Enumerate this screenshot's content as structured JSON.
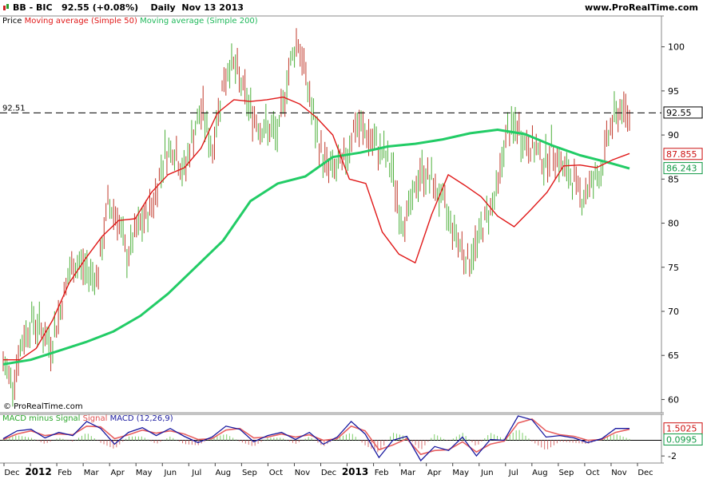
{
  "header": {
    "symbol": "BB - BIC",
    "last_price": "92.55",
    "change": "(+0.08%)",
    "period": "Daily",
    "date": "Nov 13 2013",
    "site": "www.ProRealTime.com"
  },
  "legend": {
    "price": "Price",
    "ma50": "Moving average (Simple 50)",
    "ma200": "Moving average (Simple 200)"
  },
  "watermark": "© ProRealTime.com",
  "macd_legend": {
    "hist": "MACD minus Signal",
    "signal": "Signal",
    "macd": "MACD (12,26,9)"
  },
  "colors": {
    "ma50": "#e01818",
    "ma200": "#22cc66",
    "up_bar": "#4caf3a",
    "down_bar": "#c0392b",
    "macd": "#1a1aa0",
    "signal": "#e86060",
    "ref_line": "#000000"
  },
  "chart_data": {
    "type": "line",
    "x_axis": {
      "labels": [
        "Dec",
        "2012",
        "Feb",
        "Mar",
        "Apr",
        "May",
        "Jun",
        "Jul",
        "Aug",
        "Sep",
        "Oct",
        "Nov",
        "Dec",
        "2013",
        "Feb",
        "Mar",
        "Apr",
        "May",
        "Jun",
        "Jul",
        "Aug",
        "Sep",
        "Oct",
        "Nov",
        "Dec"
      ],
      "bold_labels": [
        "2012",
        "2013"
      ]
    },
    "y_axis": {
      "ticks": [
        60,
        65,
        70,
        75,
        80,
        85,
        90,
        95,
        100
      ],
      "range": [
        58.5,
        103.5
      ]
    },
    "reference_line": {
      "value": 92.51,
      "label": "92.51",
      "style": "dashed"
    },
    "markers": [
      {
        "label": "92.55",
        "value": 92.55,
        "style": "box-black"
      },
      {
        "label": "87.855",
        "value": 87.855,
        "style": "box-red"
      },
      {
        "label": "86.243",
        "value": 86.243,
        "style": "box-green"
      }
    ],
    "price_path": [
      [
        0,
        64
      ],
      [
        1,
        62
      ],
      [
        2,
        66.5
      ],
      [
        3,
        69
      ],
      [
        4,
        68
      ],
      [
        5,
        66
      ],
      [
        6,
        70
      ],
      [
        7,
        74.5
      ],
      [
        8,
        75.5
      ],
      [
        9,
        74.5
      ],
      [
        10,
        74
      ],
      [
        11,
        82
      ],
      [
        12,
        81
      ],
      [
        13,
        76
      ],
      [
        14,
        79
      ],
      [
        15,
        80.5
      ],
      [
        16,
        83
      ],
      [
        17,
        88
      ],
      [
        18,
        88.5
      ],
      [
        19,
        85.5
      ],
      [
        20,
        90
      ],
      [
        21,
        93
      ],
      [
        22,
        88
      ],
      [
        23,
        95
      ],
      [
        24,
        98.5
      ],
      [
        25,
        96
      ],
      [
        26,
        93
      ],
      [
        27,
        91
      ],
      [
        28,
        90.5
      ],
      [
        29,
        90
      ],
      [
        30,
        97
      ],
      [
        31,
        101
      ],
      [
        32,
        96
      ],
      [
        33,
        90
      ],
      [
        34,
        86.5
      ],
      [
        35,
        86
      ],
      [
        36,
        87
      ],
      [
        37,
        91
      ],
      [
        38,
        90.5
      ],
      [
        39,
        89
      ],
      [
        40,
        88
      ],
      [
        41,
        86
      ],
      [
        42,
        80
      ],
      [
        43,
        82
      ],
      [
        44,
        86
      ],
      [
        45,
        85
      ],
      [
        46,
        83
      ],
      [
        47,
        80.5
      ],
      [
        48,
        78
      ],
      [
        49,
        75.5
      ],
      [
        50,
        78
      ],
      [
        51,
        81
      ],
      [
        52,
        83.5
      ],
      [
        53,
        90
      ],
      [
        54,
        91
      ],
      [
        55,
        89
      ],
      [
        56,
        88.5
      ],
      [
        57,
        87
      ],
      [
        58,
        88.5
      ],
      [
        59,
        86
      ],
      [
        60,
        85
      ],
      [
        61,
        83
      ],
      [
        62,
        84.5
      ],
      [
        63,
        86
      ],
      [
        64,
        91
      ],
      [
        65,
        93
      ],
      [
        66,
        92
      ]
    ],
    "series": [
      {
        "name": "Moving average (Simple 50)",
        "values": [
          [
            0,
            64.5
          ],
          [
            3,
            64.5
          ],
          [
            6,
            65.8
          ],
          [
            9,
            69
          ],
          [
            12,
            73.2
          ],
          [
            15,
            76
          ],
          [
            18,
            78.5
          ],
          [
            21,
            80.3
          ],
          [
            24,
            80.5
          ],
          [
            27,
            83.5
          ],
          [
            30,
            85.5
          ],
          [
            33,
            86.3
          ],
          [
            36,
            88.5
          ],
          [
            39,
            92.5
          ],
          [
            42,
            94
          ],
          [
            45,
            93.8
          ],
          [
            48,
            94
          ],
          [
            51,
            94.3
          ],
          [
            54,
            93.5
          ],
          [
            57,
            92
          ],
          [
            60,
            90
          ],
          [
            63,
            85
          ],
          [
            66,
            84.5
          ],
          [
            69,
            79
          ],
          [
            72,
            76.5
          ],
          [
            75,
            75.5
          ],
          [
            78,
            81
          ],
          [
            81,
            85.5
          ],
          [
            84,
            84.3
          ],
          [
            87,
            83
          ],
          [
            90,
            80.8
          ],
          [
            93,
            79.6
          ],
          [
            96,
            81.5
          ],
          [
            99,
            83.5
          ],
          [
            102,
            86.5
          ],
          [
            105,
            86.6
          ],
          [
            108,
            86.3
          ],
          [
            111,
            87.2
          ],
          [
            114,
            87.9
          ]
        ]
      },
      {
        "name": "Moving average (Simple 200)",
        "values": [
          [
            0,
            64
          ],
          [
            5,
            64.5
          ],
          [
            10,
            65.5
          ],
          [
            15,
            66.5
          ],
          [
            20,
            67.7
          ],
          [
            25,
            69.5
          ],
          [
            30,
            72
          ],
          [
            35,
            75
          ],
          [
            40,
            78
          ],
          [
            45,
            82.5
          ],
          [
            50,
            84.5
          ],
          [
            55,
            85.3
          ],
          [
            60,
            87.5
          ],
          [
            65,
            88
          ],
          [
            70,
            88.7
          ],
          [
            75,
            89
          ],
          [
            80,
            89.5
          ],
          [
            85,
            90.2
          ],
          [
            90,
            90.6
          ],
          [
            95,
            90.1
          ],
          [
            100,
            88.8
          ],
          [
            105,
            87.7
          ],
          [
            110,
            86.9
          ],
          [
            114,
            86.2
          ]
        ]
      }
    ],
    "macd": {
      "y_ticks": [
        -2
      ],
      "markers": [
        {
          "label": "1.5025",
          "value": 1.5025,
          "style": "box-red"
        },
        {
          "label": "0.0995",
          "value": 0.0995,
          "style": "box-green"
        }
      ],
      "macd_values": [
        [
          0,
          0.2
        ],
        [
          2,
          1.2
        ],
        [
          4,
          1.4
        ],
        [
          6,
          0.3
        ],
        [
          8,
          1.0
        ],
        [
          10,
          0.6
        ],
        [
          12,
          2.4
        ],
        [
          14,
          1.5
        ],
        [
          16,
          -0.5
        ],
        [
          18,
          1.0
        ],
        [
          20,
          1.6
        ],
        [
          22,
          0.6
        ],
        [
          24,
          1.5
        ],
        [
          26,
          0.5
        ],
        [
          28,
          -0.3
        ],
        [
          30,
          0.4
        ],
        [
          32,
          1.8
        ],
        [
          34,
          1.4
        ],
        [
          36,
          -0.2
        ],
        [
          38,
          0.6
        ],
        [
          40,
          1.0
        ],
        [
          42,
          0.1
        ],
        [
          44,
          1.0
        ],
        [
          46,
          -0.5
        ],
        [
          48,
          0.4
        ],
        [
          50,
          2.4
        ],
        [
          52,
          0.8
        ],
        [
          54,
          -2.2
        ],
        [
          56,
          0.0
        ],
        [
          58,
          0.5
        ],
        [
          60,
          -2.6
        ],
        [
          62,
          -0.8
        ],
        [
          64,
          -1.3
        ],
        [
          66,
          0.4
        ],
        [
          68,
          -2.0
        ],
        [
          70,
          0.1
        ],
        [
          72,
          0.0
        ],
        [
          74,
          3.1
        ],
        [
          76,
          2.6
        ],
        [
          78,
          0.4
        ],
        [
          80,
          0.6
        ],
        [
          82,
          0.3
        ],
        [
          84,
          -0.3
        ],
        [
          86,
          0.2
        ],
        [
          88,
          1.5
        ],
        [
          90,
          1.5
        ]
      ],
      "signal_values": [
        [
          0,
          0.1
        ],
        [
          2,
          0.8
        ],
        [
          4,
          1.2
        ],
        [
          6,
          0.6
        ],
        [
          8,
          0.8
        ],
        [
          10,
          0.7
        ],
        [
          12,
          1.8
        ],
        [
          14,
          1.7
        ],
        [
          16,
          0.2
        ],
        [
          18,
          0.7
        ],
        [
          20,
          1.3
        ],
        [
          22,
          0.9
        ],
        [
          24,
          1.2
        ],
        [
          26,
          0.8
        ],
        [
          28,
          0.1
        ],
        [
          30,
          0.2
        ],
        [
          32,
          1.3
        ],
        [
          34,
          1.5
        ],
        [
          36,
          0.3
        ],
        [
          38,
          0.4
        ],
        [
          40,
          0.8
        ],
        [
          42,
          0.4
        ],
        [
          44,
          0.7
        ],
        [
          46,
          0.0
        ],
        [
          48,
          0.2
        ],
        [
          50,
          1.8
        ],
        [
          52,
          1.2
        ],
        [
          54,
          -1.2
        ],
        [
          56,
          -0.6
        ],
        [
          58,
          0.2
        ],
        [
          60,
          -1.8
        ],
        [
          62,
          -1.3
        ],
        [
          64,
          -1.2
        ],
        [
          66,
          -0.2
        ],
        [
          68,
          -1.5
        ],
        [
          70,
          -0.5
        ],
        [
          72,
          -0.1
        ],
        [
          74,
          2.2
        ],
        [
          76,
          2.7
        ],
        [
          78,
          1.2
        ],
        [
          80,
          0.7
        ],
        [
          82,
          0.5
        ],
        [
          84,
          0.0
        ],
        [
          86,
          0.1
        ],
        [
          88,
          1.0
        ],
        [
          90,
          1.4
        ]
      ]
    }
  }
}
